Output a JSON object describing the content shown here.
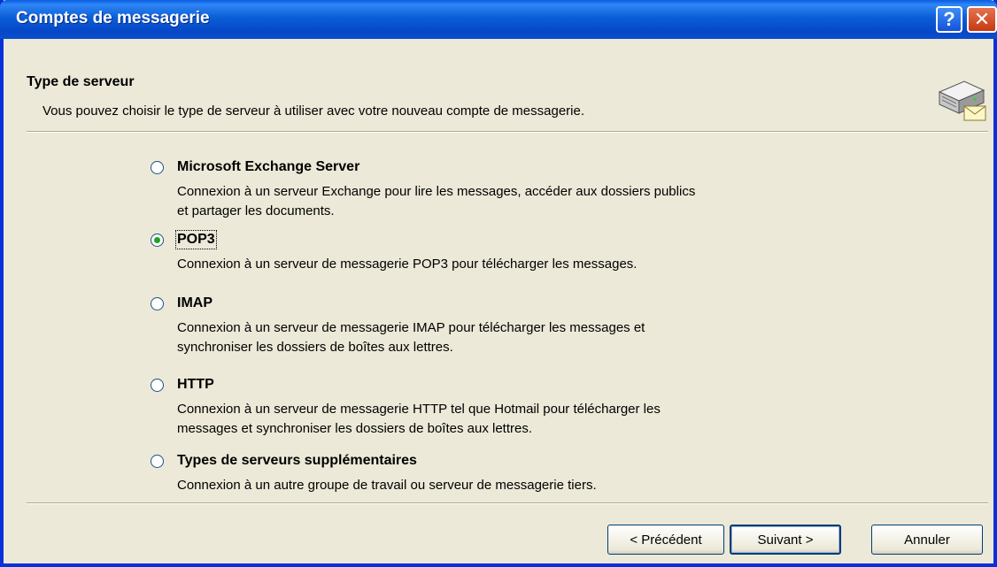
{
  "window": {
    "title": "Comptes de messagerie",
    "help_glyph": "?",
    "close_glyph": "✕"
  },
  "header": {
    "title": "Type de serveur",
    "subtitle": "Vous pouvez choisir le type de serveur à utiliser avec votre nouveau compte de messagerie.",
    "icon": "server-mail-icon"
  },
  "options": [
    {
      "label": "Microsoft Exchange Server",
      "selected": false,
      "desc1": "Connexion à un serveur Exchange pour lire les messages, accéder aux dossiers publics",
      "desc2": "et partager les documents."
    },
    {
      "label": "POP3",
      "selected": true,
      "desc1": "Connexion à un serveur de messagerie POP3 pour télécharger les messages.",
      "desc2": ""
    },
    {
      "label": "IMAP",
      "selected": false,
      "desc1": "Connexion à un serveur de messagerie IMAP pour télécharger les messages et",
      "desc2": "synchroniser les dossiers de boîtes aux lettres."
    },
    {
      "label": "HTTP",
      "selected": false,
      "desc1": "Connexion à un serveur de messagerie HTTP tel que Hotmail pour télécharger les",
      "desc2": "messages et synchroniser les dossiers de boîtes aux lettres."
    },
    {
      "label": "Types de serveurs supplémentaires",
      "selected": false,
      "desc1": "Connexion à un autre groupe de travail ou serveur de messagerie tiers.",
      "desc2": ""
    }
  ],
  "buttons": {
    "back": "< Précédent",
    "next": "Suivant >",
    "cancel": "Annuler"
  }
}
